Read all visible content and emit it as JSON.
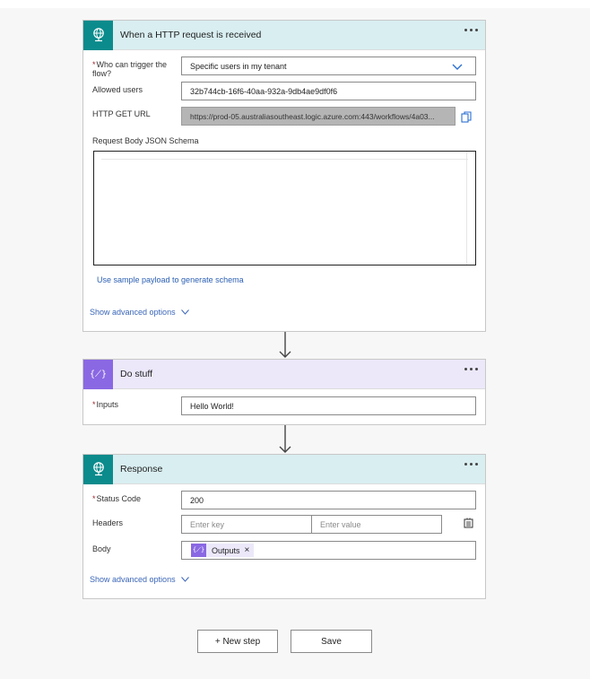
{
  "trigger": {
    "title": "When a HTTP request is received",
    "who_label_line1": "Who can trigger the",
    "who_label_line2": "flow?",
    "who_value": "Specific users in my tenant",
    "allowed_users_label": "Allowed users",
    "allowed_users_value": "32b744cb-16f6-40aa-932a-9db4ae9df0f6",
    "url_label": "HTTP GET URL",
    "url_value": "https://prod-05.australiasoutheast.logic.azure.com:443/workflows/4a03...",
    "schema_label": "Request Body JSON Schema",
    "sample_link": "Use sample payload to generate schema",
    "advanced": "Show advanced options"
  },
  "compose": {
    "title": "Do stuff",
    "inputs_label": "Inputs",
    "inputs_value": "Hello World!",
    "icon_glyph": "{⟋}"
  },
  "response": {
    "title": "Response",
    "status_label": "Status Code",
    "status_value": "200",
    "headers_label": "Headers",
    "key_placeholder": "Enter key",
    "value_placeholder": "Enter value",
    "body_label": "Body",
    "token_label": "Outputs",
    "token_remove": "×",
    "advanced": "Show advanced options"
  },
  "footer": {
    "new_step": "+ New step",
    "save": "Save"
  },
  "required_mark": "*",
  "colors": {
    "http_header": "#d9eef1",
    "http_icon": "#0b8b8c",
    "compose_header": "#ece8fa",
    "compose_icon": "#8a68e3",
    "link": "#2b5fb3"
  }
}
